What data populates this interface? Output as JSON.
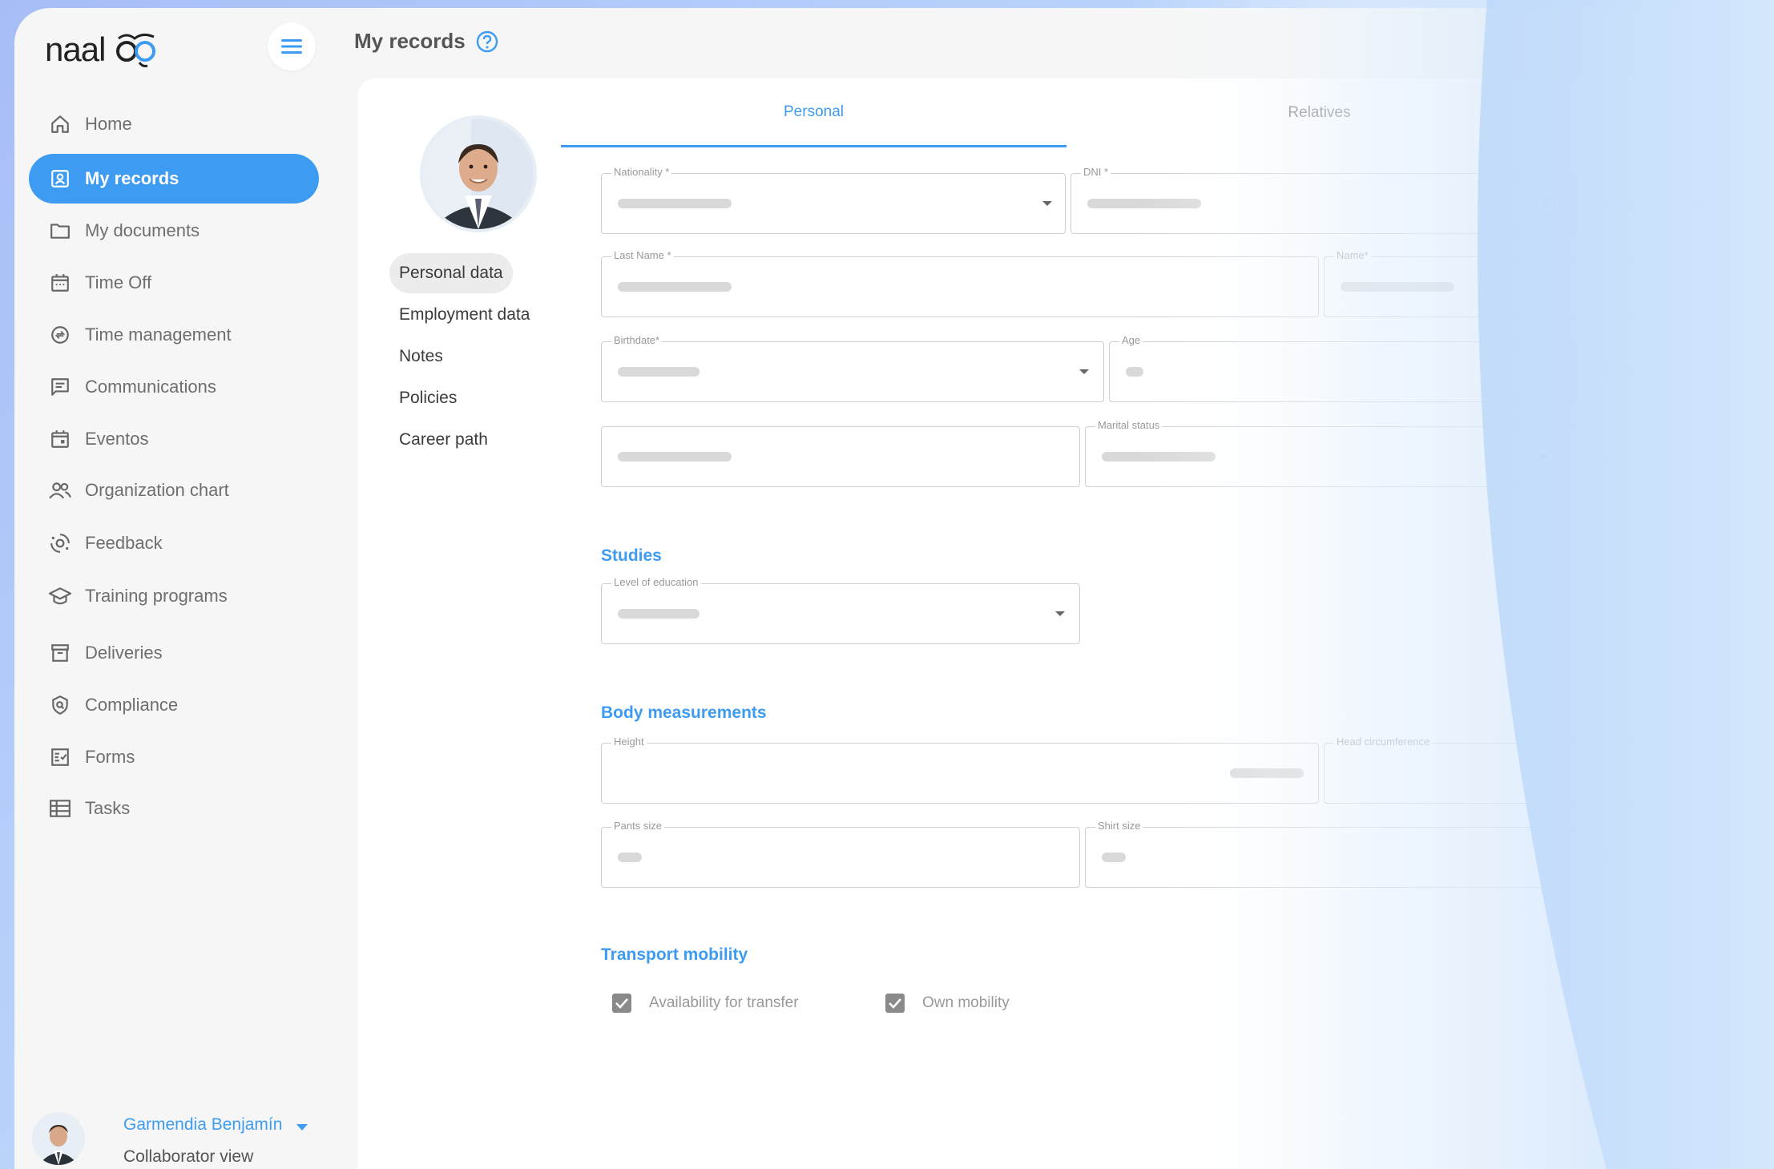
{
  "app": {
    "logo_text": "naaloo"
  },
  "sidebar": {
    "items": [
      {
        "label": "Home",
        "icon": "home-icon"
      },
      {
        "label": "My records",
        "icon": "id-card-icon",
        "active": true
      },
      {
        "label": "My documents",
        "icon": "folder-icon"
      },
      {
        "label": "Time Off",
        "icon": "calendar-icon"
      },
      {
        "label": "Time management",
        "icon": "clock-icon"
      },
      {
        "label": "Communications",
        "icon": "chat-icon"
      },
      {
        "label": "Eventos",
        "icon": "event-icon"
      },
      {
        "label": "Organization chart",
        "icon": "people-icon"
      },
      {
        "label": "Feedback",
        "icon": "feedback-icon"
      },
      {
        "label": "Training programs",
        "icon": "graduation-cap-icon"
      },
      {
        "label": "Deliveries",
        "icon": "archive-icon"
      },
      {
        "label": "Compliance",
        "icon": "shield-icon"
      },
      {
        "label": "Forms",
        "icon": "form-icon"
      },
      {
        "label": "Tasks",
        "icon": "table-icon"
      }
    ],
    "user": {
      "name": "Garmendia Benjamín",
      "role": "Collaborator view"
    }
  },
  "header": {
    "title": "My records"
  },
  "subnav": {
    "items": [
      {
        "label": "Personal data",
        "active": true
      },
      {
        "label": "Employment data"
      },
      {
        "label": "Notes"
      },
      {
        "label": "Policies"
      },
      {
        "label": "Career path"
      }
    ]
  },
  "tabs": [
    {
      "label": "Personal",
      "active": true
    },
    {
      "label": "Relatives"
    }
  ],
  "fields": {
    "nationality": "Nationality *",
    "dni": "DNI *",
    "last_name": "Last Name *",
    "name": "Name*",
    "birthdate": "Birthdate*",
    "age": "Age",
    "marital_status": "Marital status",
    "level_of_education": "Level of education",
    "height": "Height",
    "head_circumference": "Head circumference",
    "pants_size": "Pants size",
    "shirt_size": "Shirt size"
  },
  "sections": {
    "studies": "Studies",
    "body_measurements": "Body measurements",
    "transport_mobility": "Transport mobility"
  },
  "checkboxes": [
    {
      "label": "Availability for transfer",
      "checked": true
    },
    {
      "label": "Own mobility",
      "checked": true
    }
  ],
  "colors": {
    "accent": "#3d9cf1",
    "background": "#f6f6f6"
  }
}
